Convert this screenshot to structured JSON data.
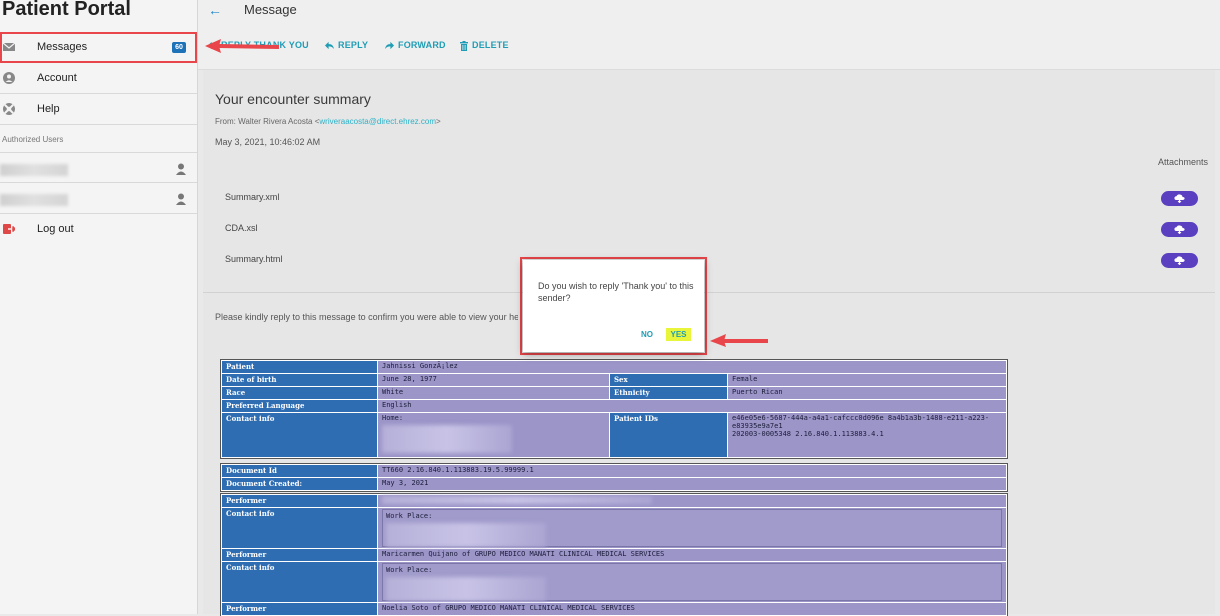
{
  "sidebar": {
    "title": "Patient Portal",
    "items": [
      {
        "label": "Messages",
        "icon": "mail-icon",
        "badge": "60"
      },
      {
        "label": "Account",
        "icon": "account-icon"
      },
      {
        "label": "Help",
        "icon": "help-icon"
      }
    ],
    "authorized_users_label": "Authorized Users",
    "logout_label": "Log out"
  },
  "header": {
    "title": "Message"
  },
  "toolbar": {
    "reply_thank_you": "REPLY THANK YOU",
    "reply": "REPLY",
    "forward": "FORWARD",
    "delete": "DELETE"
  },
  "message": {
    "subject": "Your encounter summary",
    "from_prefix": "From: Walter Rivera Acosta <",
    "from_email": "wriveraacosta@direct.ehrez.com",
    "from_suffix": ">",
    "date": "May 3, 2021, 10:46:02 AM",
    "attachments_label": "Attachments",
    "attachments": [
      "Summary.xml",
      "CDA.xsl",
      "Summary.html"
    ],
    "body": "Please kindly reply to this message to confirm you were able to view your he"
  },
  "dialog": {
    "text": "Do you wish to reply 'Thank you' to this sender?",
    "no": "NO",
    "yes": "YES"
  },
  "document": {
    "patient_label": "Patient",
    "patient": "Jahnissi GonzÃ¡lez",
    "dob_label": "Date of birth",
    "dob": "June 28, 1977",
    "sex_label": "Sex",
    "sex": "Female",
    "race_label": "Race",
    "race": "White",
    "ethnicity_label": "Ethnicity",
    "ethnicity": "Puerto Rican",
    "language_label": "Preferred Language",
    "language": "English",
    "contact_label": "Contact info",
    "contact_home": "Home:",
    "patient_ids_label": "Patient IDs",
    "patient_ids_1": "e46e05e6-5687-444a-a4a1-cafccc0d096e 8a4b1a3b-1488-e211-a223-e83935e9a7e1",
    "patient_ids_2": "202003-0005348 2.16.840.1.113883.4.1",
    "doc_id_label": "Document Id",
    "doc_id": "TT660 2.16.840.1.113883.19.5.99999.1",
    "doc_created_label": "Document Created:",
    "doc_created": "May 3, 2021",
    "performer_label": "Performer",
    "contact_info_label": "Contact info",
    "work_place": "Work Place:",
    "performer2": "Maricarmen Quijano of GRUPO MEDICO MANATI CLINICAL MEDICAL SERVICES",
    "performer3": "Noelia Soto of GRUPO MEDICO MANATI CLINICAL MEDICAL SERVICES"
  },
  "colors": {
    "accent": "#1f9db5",
    "badge": "#1e73b8",
    "attachment_button": "#5a3fc0",
    "highlight": "#e8464a",
    "yes_highlight": "#e8f53a",
    "table_key": "#2f6db3",
    "table_value": "#9b95c8"
  }
}
